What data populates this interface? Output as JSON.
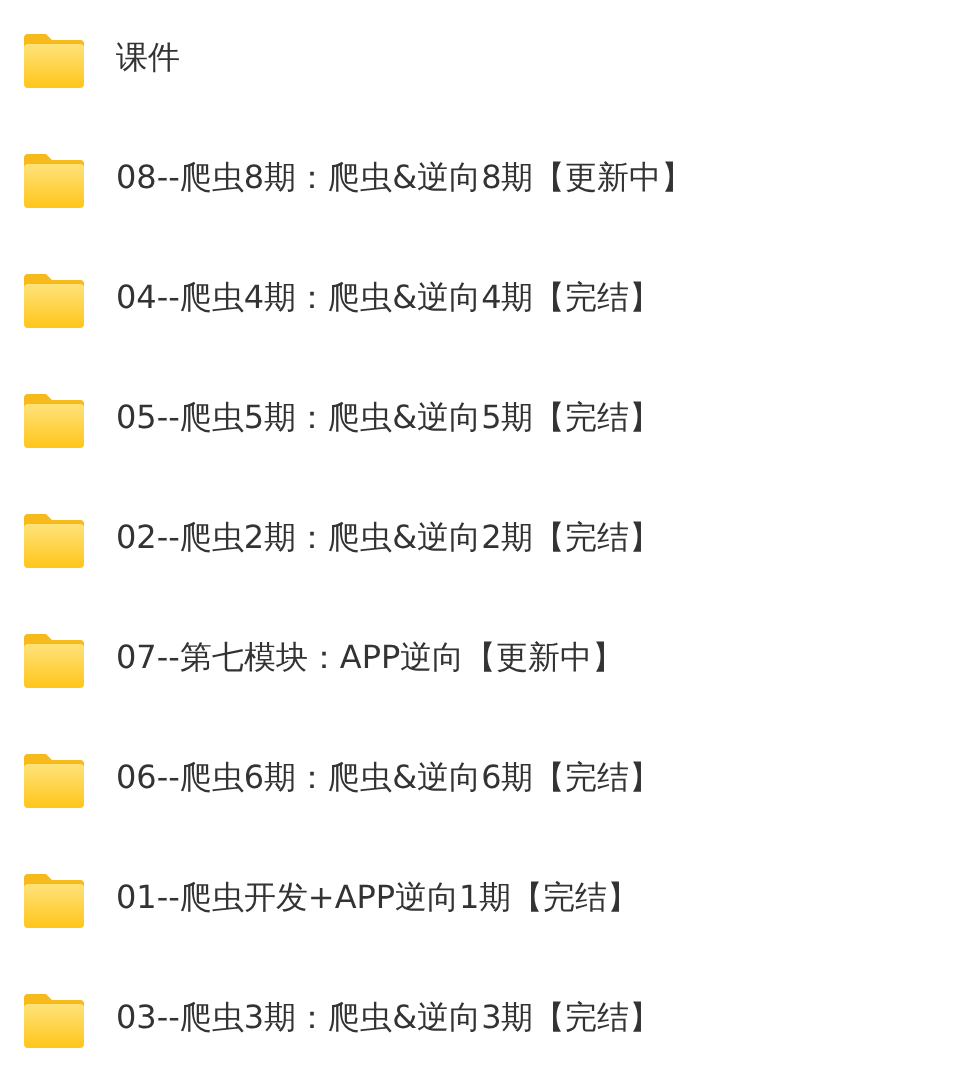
{
  "folders": [
    {
      "name": "课件"
    },
    {
      "name": "08--爬虫8期：爬虫&逆向8期【更新中】"
    },
    {
      "name": "04--爬虫4期：爬虫&逆向4期【完结】"
    },
    {
      "name": "05--爬虫5期：爬虫&逆向5期【完结】"
    },
    {
      "name": "02--爬虫2期：爬虫&逆向2期【完结】"
    },
    {
      "name": "07--第七模块：APP逆向【更新中】"
    },
    {
      "name": "06--爬虫6期：爬虫&逆向6期【完结】"
    },
    {
      "name": "01--爬虫开发+APP逆向1期【完结】"
    },
    {
      "name": "03--爬虫3期：爬虫&逆向3期【完结】"
    }
  ]
}
